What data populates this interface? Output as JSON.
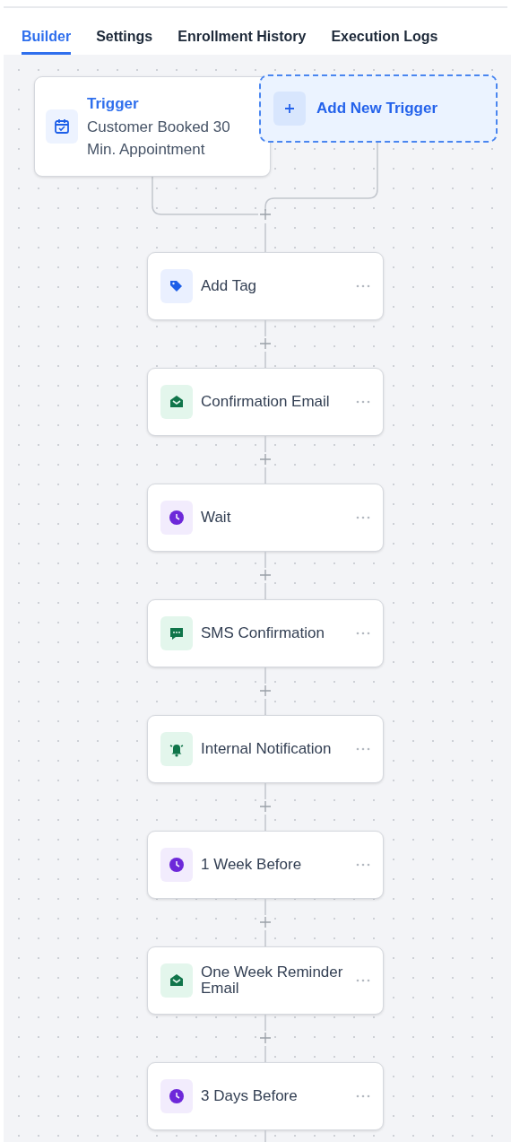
{
  "tabs": [
    {
      "label": "Builder",
      "selected": true
    },
    {
      "label": "Settings",
      "selected": false
    },
    {
      "label": "Enrollment History",
      "selected": false
    },
    {
      "label": "Execution Logs",
      "selected": false
    }
  ],
  "trigger": {
    "title": "Trigger",
    "description": "Customer Booked 30 Min. Appointment"
  },
  "add_trigger": {
    "label": "Add New Trigger"
  },
  "actions": [
    {
      "kind": "tag",
      "label": "Add Tag"
    },
    {
      "kind": "email",
      "label": "Confirmation Email"
    },
    {
      "kind": "wait",
      "label": "Wait"
    },
    {
      "kind": "sms",
      "label": "SMS Confirmation"
    },
    {
      "kind": "notification",
      "label": "Internal Notification"
    },
    {
      "kind": "wait",
      "label": "1 Week Before"
    },
    {
      "kind": "email",
      "label": "One Week Reminder Email"
    },
    {
      "kind": "wait",
      "label": "3 Days Before"
    }
  ]
}
